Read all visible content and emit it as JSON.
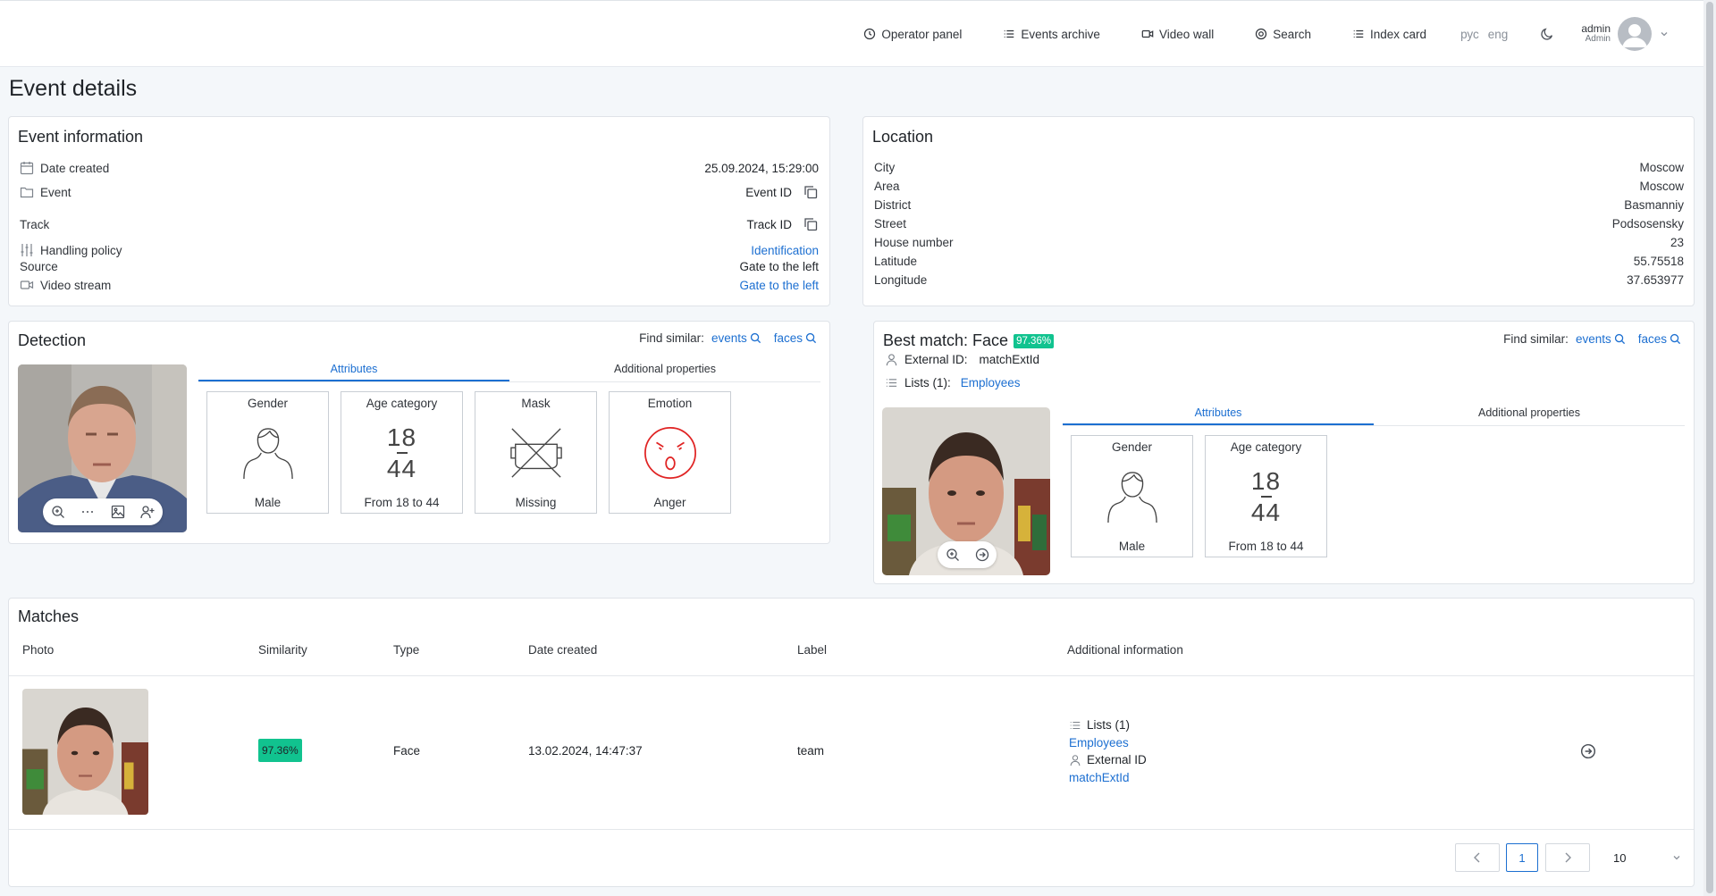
{
  "nav": {
    "operator_panel": "Operator panel",
    "events_archive": "Events archive",
    "video_wall": "Video wall",
    "search": "Search",
    "index_card": "Index card",
    "lang_ru": "рус",
    "lang_en": "eng",
    "user_name": "admin",
    "user_role": "Admin"
  },
  "page_title": "Event details",
  "event_info": {
    "title": "Event information",
    "date_label": "Date created",
    "date_value": "25.09.2024, 15:29:00",
    "event_label": "Event",
    "event_id_label": "Event ID",
    "track_label": "Track",
    "track_id_label": "Track ID",
    "policy_label": "Handling policy",
    "policy_value": "Identification",
    "source_label": "Source",
    "source_value": "Gate to the left",
    "stream_label": "Video stream",
    "stream_value": "Gate to the left"
  },
  "location": {
    "title": "Location",
    "rows": [
      {
        "label": "City",
        "value": "Moscow"
      },
      {
        "label": "Area",
        "value": "Moscow"
      },
      {
        "label": "District",
        "value": "Basmanniy"
      },
      {
        "label": "Street",
        "value": "Podsosensky"
      },
      {
        "label": "House number",
        "value": "23"
      },
      {
        "label": "Latitude",
        "value": "55.75518"
      },
      {
        "label": "Longitude",
        "value": "37.653977"
      }
    ]
  },
  "detection": {
    "title": "Detection",
    "find_similar": "Find similar:",
    "events_link": "events",
    "faces_link": "faces",
    "tab_attributes": "Attributes",
    "tab_additional": "Additional properties",
    "gender_title": "Gender",
    "gender_value": "Male",
    "age_title": "Age category",
    "age_min": "18",
    "age_max": "44",
    "age_value": "From 18 to 44",
    "mask_title": "Mask",
    "mask_value": "Missing",
    "emotion_title": "Emotion",
    "emotion_value": "Anger"
  },
  "best_match": {
    "title": "Best match: Face",
    "similarity": "97.36%",
    "find_similar": "Find similar:",
    "events_link": "events",
    "faces_link": "faces",
    "external_id_label": "External ID:",
    "external_id_value": "matchExtId",
    "lists_label": "Lists (1):",
    "lists_value": "Employees",
    "tab_attributes": "Attributes",
    "tab_additional": "Additional properties",
    "gender_title": "Gender",
    "gender_value": "Male",
    "age_title": "Age category",
    "age_min": "18",
    "age_max": "44",
    "age_value": "From 18 to 44"
  },
  "matches": {
    "title": "Matches",
    "columns": [
      "Photo",
      "Similarity",
      "Type",
      "Date created",
      "Label",
      "Additional information"
    ],
    "rows": [
      {
        "similarity": "97.36%",
        "type": "Face",
        "date": "13.02.2024, 14:47:37",
        "label": "team",
        "lists_label": "Lists (1)",
        "lists_value": "Employees",
        "external_id_label": "External ID",
        "external_id_value": "matchExtId"
      }
    ]
  },
  "pager": {
    "current_page": "1",
    "page_size": "10"
  },
  "colors": {
    "accent": "#1c6fd1",
    "badge": "#11c38f",
    "emotion": "#e02424"
  }
}
